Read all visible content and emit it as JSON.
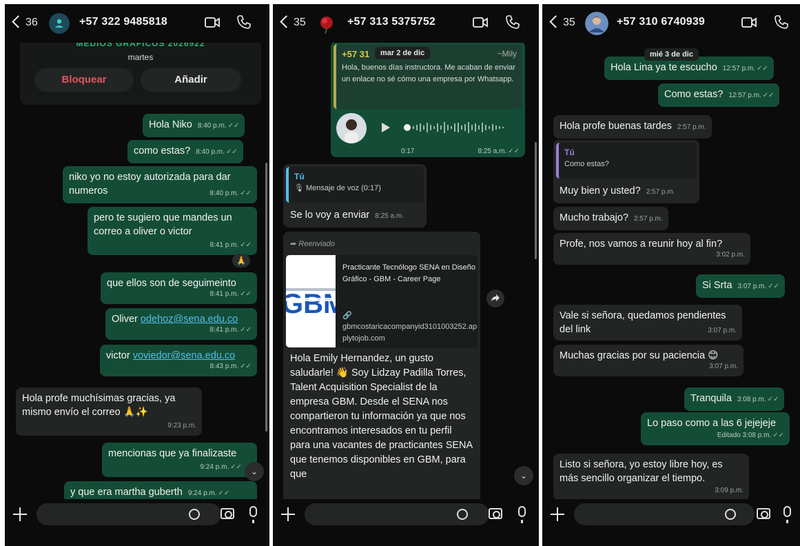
{
  "panel1": {
    "header": {
      "count": "36",
      "phone": "+57 322 9485818"
    },
    "card": {
      "title": "MEDIOS GRÁFICOS 2026922",
      "day": "martes",
      "block_label": "Bloquear",
      "add_label": "Añadir"
    },
    "messages": [
      {
        "text": "Hola Niko",
        "time": "8:40 p.m."
      },
      {
        "text": "como estas?",
        "time": "8:40 p.m."
      },
      {
        "text": "niko yo no estoy autorizada para dar numeros",
        "time": "8:40 p.m."
      },
      {
        "text": "pero te sugiero que mandes un correo a oliver o victor",
        "time": "8:41 p.m.",
        "reaction": "🙏"
      },
      {
        "text": "que ellos son de seguimeinto",
        "time": "8:41 p.m."
      },
      {
        "text": "Oliver",
        "link": "odehoz@sena.edu.co",
        "time": "8:41 p.m."
      },
      {
        "text": "victor",
        "link": "voviedor@sena.edu.co",
        "time": "8:43 p.m."
      },
      {
        "text": "Hola profe muchísimas gracias, ya mismo envío el correo 🙏✨",
        "time": "9:23 p.m."
      },
      {
        "text": "mencionas que ya finalizaste",
        "time": "9:24 p.m."
      },
      {
        "text": "y que era martha guberth",
        "time": "9:24 p.m."
      }
    ]
  },
  "panel2": {
    "header": {
      "count": "35",
      "phone": "+57 313 5375752"
    },
    "quote": {
      "sender": "+57 31",
      "date_chip": "mar 2 de dic",
      "name": "~Mily",
      "text": "Hola, buenos días instructora. Me acaban de enviar un enlace no sé cómo una empresa por Whatsapp."
    },
    "voice": {
      "duration": "0:17",
      "time": "8:25 a.m."
    },
    "reply": {
      "author": "Tú",
      "quoted": "Mensaje de voz (0:17)",
      "text": "Se lo voy a enviar",
      "time": "8:25 a.m."
    },
    "forwarded": {
      "label": "Reenviado",
      "preview_title": "Practicante Tecnólogo SENA en Diseño Gráfico - GBM - Career Page",
      "preview_url": "gbmcostaricacompanyid3101003252.applytojob.com",
      "logo_text": "GBM",
      "body": "Hola Emily Hernandez, un gusto saludarle! 👋 Soy Lidzay Padilla Torres, Talent Acquisition Specialist de la empresa GBM. Desde el SENA nos compartieron tu información ya que nos encontramos interesados en tu perfil para una vacantes de practicantes SENA que tenemos disponibles en GBM, para que"
    }
  },
  "panel3": {
    "header": {
      "count": "35",
      "phone": "+57 310 6740939"
    },
    "date_chip": "mié 3 de dic",
    "messages": [
      {
        "text": "Hola Lina ya te escucho",
        "time": "12:57 p.m."
      },
      {
        "text": "Como estas?",
        "time": "12:57 p.m."
      },
      {
        "text": "Hola profe buenas tardes",
        "time": "2:57 p.m."
      },
      {
        "author": "Tú",
        "quoted": "Como estas?",
        "text": "Muy bien y usted?",
        "time": "2:57 p.m."
      },
      {
        "text": "Mucho trabajo?",
        "time": "2:57 p.m."
      },
      {
        "text": "Profe, nos vamos a reunir hoy al fin?",
        "time": "3:02 p.m."
      },
      {
        "text": "Si Srta",
        "time": "3:07 p.m."
      },
      {
        "text": "Vale si señora, quedamos pendientes del link",
        "time": "3:07 p.m."
      },
      {
        "text": "Muchas gracias por su paciencia 😊",
        "time": "3:07 p.m."
      },
      {
        "text": "Tranquila",
        "time": "3:08 p.m."
      },
      {
        "text": "Lo paso como a las 6 jejejeje",
        "edited": "Editado",
        "time": "3:08 p.m."
      },
      {
        "text": "Listo si señora, yo estoy libre hoy, es más sencillo organizar el tiempo.",
        "time": "3:09 p.m."
      }
    ]
  },
  "colors": {
    "outgoing": "#144d37",
    "incoming": "#222524",
    "background": "#0b0b0b",
    "link": "#53bdeb",
    "danger": "#e05561"
  },
  "icons": [
    "back-chevron-icon",
    "video-call-icon",
    "phone-call-icon",
    "plus-icon",
    "sticker-icon",
    "camera-icon",
    "microphone-icon",
    "read-ticks-icon",
    "play-icon",
    "share-icon",
    "chevron-down-icon",
    "forward-icon",
    "link-icon"
  ]
}
